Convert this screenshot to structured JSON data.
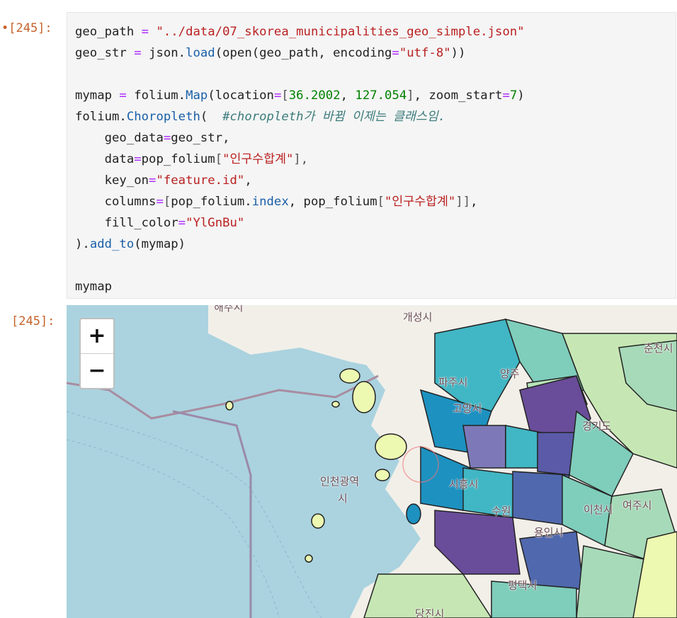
{
  "cells": [
    {
      "prompt_in": "•[245]:",
      "prompt_out": "[245]:",
      "code_lines": {
        "l1": {
          "a": "geo_path",
          "b": " = ",
          "c": "\"../data/07_skorea_municipalities_geo_simple.json\""
        },
        "l2": {
          "a": "geo_str",
          "b": " = ",
          "c": "json.",
          "d": "load",
          "e": "(open(geo_path, encoding",
          "f": "=",
          "g": "\"utf-8\"",
          "h": "))"
        },
        "l4": {
          "a": "mymap",
          "b": " = ",
          "c": "folium.",
          "d": "Map",
          "e": "(location",
          "f": "=",
          "g": "[",
          "h": "36.2002",
          "i": ", ",
          "j": "127.054",
          "k": "]",
          "l": ", zoom_start",
          "m": "=",
          "n": "7",
          "o": ")"
        },
        "l5": {
          "a": "folium.",
          "b": "Choropleth",
          "c": "(  ",
          "d": "#choropleth가 바뀜 이제는 클래스임."
        },
        "l6": {
          "a": "    geo_data",
          "b": "=",
          "c": "geo_str,"
        },
        "l7": {
          "a": "    data",
          "b": "=",
          "c": "pop_folium",
          "d": "[",
          "e": "\"인구수합계\"",
          "f": "],"
        },
        "l8": {
          "a": "    key_on",
          "b": "=",
          "c": "\"feature.id\"",
          "d": ","
        },
        "l9": {
          "a": "    columns",
          "b": "=",
          "c": "[",
          "d": "pop_folium.",
          "e": "index",
          "f": ", pop_folium",
          "g": "[",
          "h": "\"인구수합계\"",
          "i": "]]",
          "j": ","
        },
        "l10": {
          "a": "    fill_color",
          "b": "=",
          "c": "\"YlGnBu\""
        },
        "l11": {
          "a": ").",
          "b": "add_to",
          "c": "(mymap)"
        },
        "l13": {
          "a": "mymap"
        }
      }
    }
  ],
  "map": {
    "zoom_in": "+",
    "zoom_out": "−",
    "labels": {
      "kaesong": "개성시",
      "paju": "파주시",
      "incheon1": "인천광역",
      "incheon2": "시",
      "chuncheon": "춘천시",
      "yeoju": "여주시",
      "icheon": "이천시",
      "pyeongtaek": "평택시",
      "dangjin": "당진시",
      "gyeonggi": "경기도",
      "yangju": "양주",
      "haeju": "해주시",
      "goyang": "고양시",
      "siheung": "시흥시",
      "suwon": "수원",
      "yongin": "용인시"
    },
    "colormap": "YlGnBu"
  }
}
